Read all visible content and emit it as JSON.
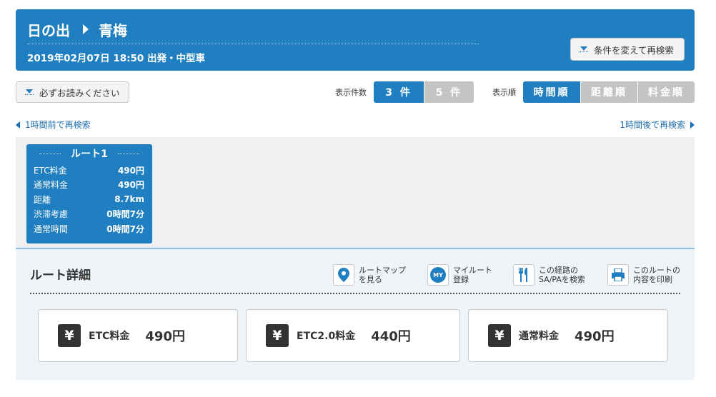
{
  "header": {
    "from": "日の出",
    "to": "青梅",
    "subtitle": "2019年02月07日 18:50 出発・中型車",
    "research_button": "条件を変えて再検索"
  },
  "toolbar": {
    "notice_button": "必ずお読みください",
    "count_label": "表示件数",
    "count_options": [
      "3 件",
      "5 件"
    ],
    "count_selected": "3 件",
    "order_label": "表示順",
    "order_options": [
      "時間順",
      "距離順",
      "料金順"
    ],
    "order_selected": "時間順"
  },
  "time_links": {
    "earlier": "1時間前で再検索",
    "later": "1時間後で再検索"
  },
  "route_card": {
    "title": "ルート1",
    "rows": [
      {
        "label": "ETC料金",
        "value": "490円"
      },
      {
        "label": "通常料金",
        "value": "490円"
      },
      {
        "label": "距離",
        "value": "8.7km"
      },
      {
        "label": "渋滞考慮",
        "value": "0時間7分"
      },
      {
        "label": "通常時間",
        "value": "0時間7分"
      }
    ]
  },
  "detail": {
    "title": "ルート詳細",
    "actions": [
      {
        "line1": "ルートマップ",
        "line2": "を見る",
        "icon": "map-pin-icon"
      },
      {
        "line1": "マイルート",
        "line2": "登録",
        "icon": "my-icon",
        "badge": "MY"
      },
      {
        "line1": "この経路の",
        "line2": "SA/PAを検索",
        "icon": "fork-knife-icon"
      },
      {
        "line1": "このルートの",
        "line2": "内容を印刷",
        "icon": "printer-icon"
      }
    ],
    "fees": [
      {
        "label": "ETC料金",
        "value": "490円"
      },
      {
        "label": "ETC2.0料金",
        "value": "440円"
      },
      {
        "label": "通常料金",
        "value": "490円"
      }
    ],
    "yen_symbol": "¥"
  },
  "colors": {
    "primary": "#1f7fc0",
    "segment_off": "#c4c4c4",
    "link": "#1f6fb0"
  }
}
